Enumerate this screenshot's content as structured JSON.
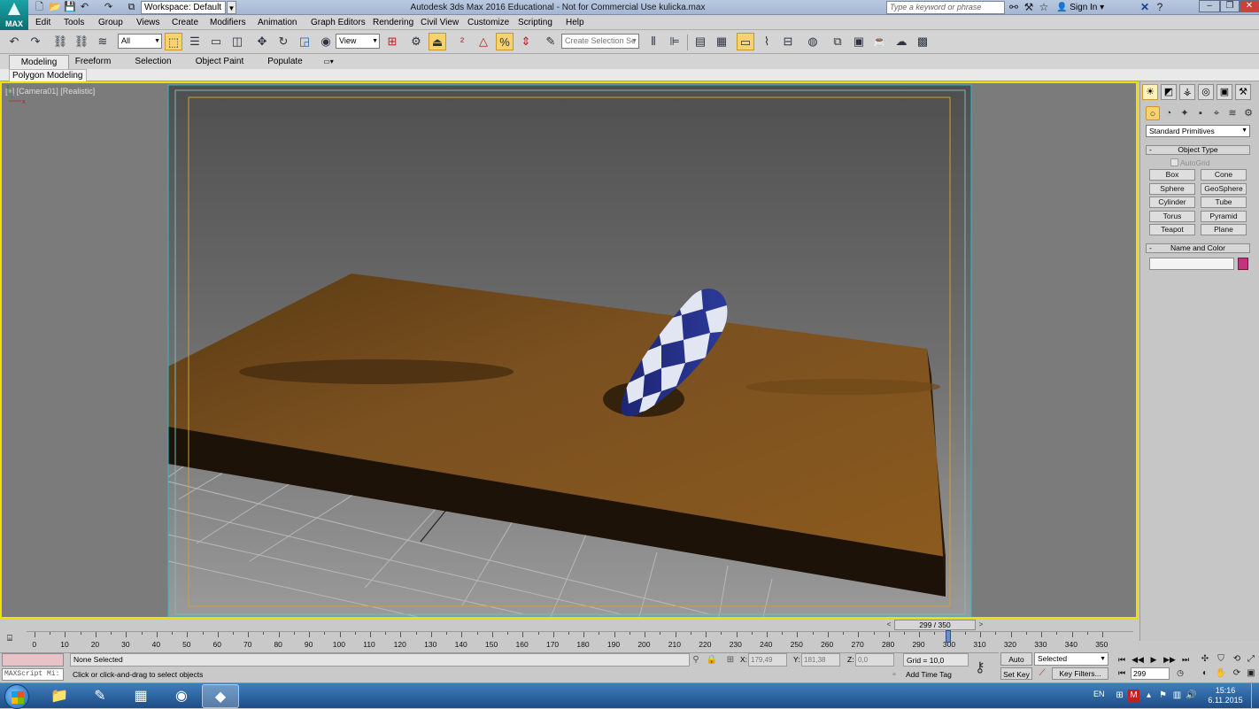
{
  "title_bar": {
    "app_logo": "MAX",
    "workspace": "Workspace: Default",
    "window_title": "Autodesk 3ds Max 2016 Educational - Not for Commercial Use   kulicka.max",
    "search_placeholder": "Type a keyword or phrase",
    "sign_in": "Sign In"
  },
  "menu": [
    "Edit",
    "Tools",
    "Group",
    "Views",
    "Create",
    "Modifiers",
    "Animation",
    "Graph Editors",
    "Rendering",
    "Civil View",
    "Customize",
    "Scripting",
    "Help"
  ],
  "toolbar": {
    "selection_filter": "All",
    "ref_coord": "View",
    "named_selection_placeholder": "Create Selection Se"
  },
  "ribbon": {
    "tabs": [
      "Modeling",
      "Freeform",
      "Selection",
      "Object Paint",
      "Populate"
    ],
    "active_tab": "Modeling",
    "panel_label": "Polygon Modeling"
  },
  "viewport": {
    "label": "[+] [Camera01] [Realistic]"
  },
  "command_panel": {
    "category": "Standard Primitives",
    "object_type_title": "Object Type",
    "autogrid_label": "AutoGrid",
    "object_buttons": [
      "Box",
      "Cone",
      "Sphere",
      "GeoSphere",
      "Cylinder",
      "Tube",
      "Torus",
      "Pyramid",
      "Teapot",
      "Plane"
    ],
    "name_color_title": "Name and Color",
    "object_color": "#c4337e"
  },
  "timeline": {
    "slider_label": "299 / 350",
    "ticks": [
      0,
      10,
      20,
      30,
      40,
      50,
      60,
      70,
      80,
      90,
      100,
      110,
      120,
      130,
      140,
      150,
      160,
      170,
      180,
      190,
      200,
      210,
      220,
      230,
      240,
      250,
      260,
      270,
      280,
      290,
      300,
      310,
      320,
      330,
      340,
      350
    ]
  },
  "status": {
    "maxscript": "MAXScript Mi:",
    "selection": "None Selected",
    "prompt": "Click or click-and-drag to select objects",
    "x_label": "X:",
    "x_value": "179,49",
    "y_label": "Y:",
    "y_value": "181,38",
    "z_label": "Z:",
    "z_value": "0,0",
    "grid": "Grid = 10,0",
    "add_time_tag": "Add Time Tag"
  },
  "animation": {
    "auto_key": "Auto Key",
    "set_key": "Set Key",
    "key_mode": "Selected",
    "key_filters": "Key Filters...",
    "current_frame": "299"
  },
  "taskbar": {
    "language": "EN",
    "time": "15:16",
    "date": "6.11.2015"
  }
}
